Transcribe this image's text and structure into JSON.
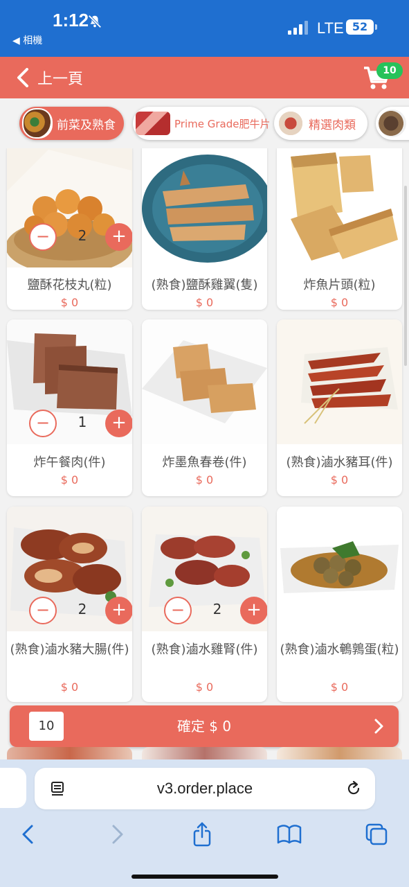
{
  "status_bar": {
    "time": "1:12",
    "back_app": "◀ 相機",
    "carrier": "LTE",
    "battery": "52"
  },
  "header": {
    "back_label": "上一頁",
    "cart_count": "10"
  },
  "categories": [
    {
      "label": "前菜及熟食",
      "active": true
    },
    {
      "label": "Prime Grade肥牛片",
      "active": false
    },
    {
      "label": "精選肉類",
      "active": false
    }
  ],
  "products": [
    {
      "name": "鹽酥花枝丸(粒)",
      "price": "$ 0",
      "qty": "2"
    },
    {
      "name": "(熟食)鹽酥雞翼(隻)",
      "price": "$ 0"
    },
    {
      "name": "炸魚片頭(粒)",
      "price": "$ 0"
    },
    {
      "name": "炸午餐肉(件)",
      "price": "$ 0",
      "qty": "1"
    },
    {
      "name": "炸墨魚春卷(件)",
      "price": "$ 0"
    },
    {
      "name": "(熟食)滷水豬耳(件)",
      "price": "$ 0"
    },
    {
      "name": "(熟食)滷水豬大腸(件)",
      "price": "$ 0",
      "qty": "2"
    },
    {
      "name": "(熟食)滷水雞腎(件)",
      "price": "$ 0",
      "qty": "2"
    },
    {
      "name": "(熟食)滷水鵪鶉蛋(粒)",
      "price": "$ 0"
    }
  ],
  "qty_controls": {
    "minus": "−",
    "plus": "+"
  },
  "confirm": {
    "count": "10",
    "label": "確定 $ 0"
  },
  "browser": {
    "url": "v3.order.place"
  },
  "colors": {
    "accent": "#e96a5c",
    "status_bar": "#1f6fd0",
    "badge": "#27c25a",
    "browser": "#d7e3f3"
  }
}
